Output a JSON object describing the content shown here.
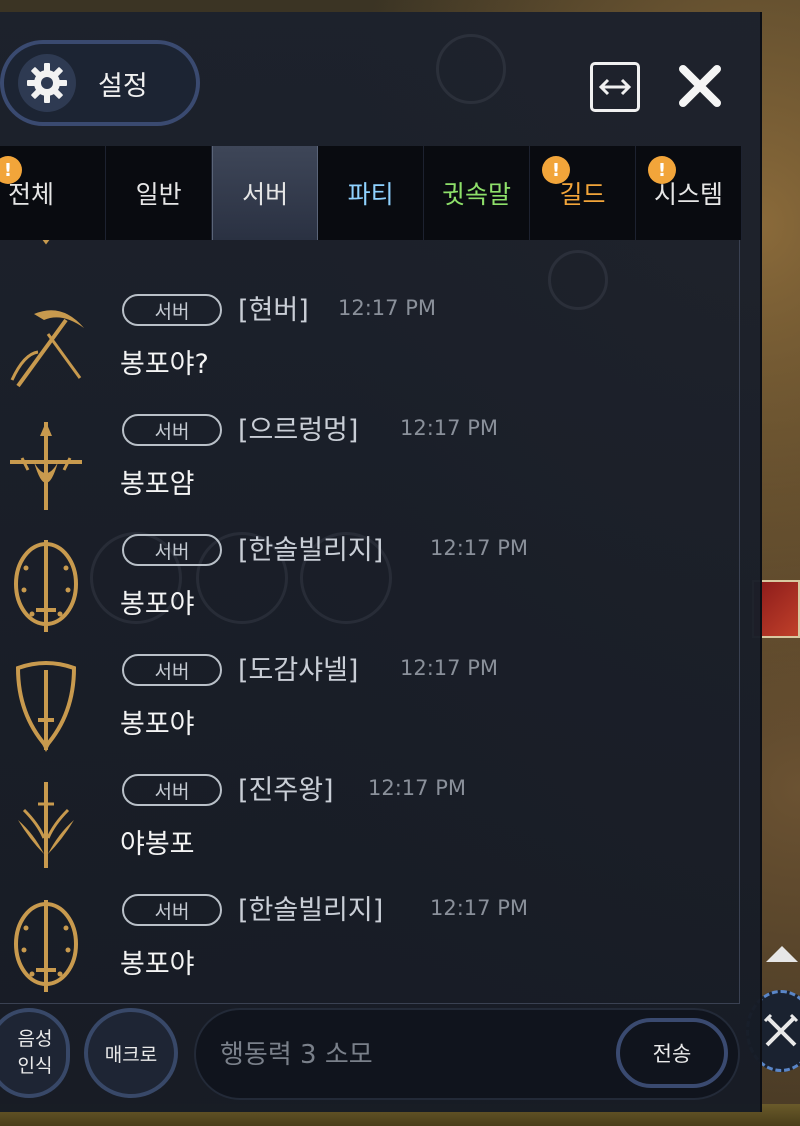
{
  "header": {
    "settings_label": "설정"
  },
  "tabs": [
    {
      "label": "전체",
      "alert": true,
      "color": "#e6e6e6"
    },
    {
      "label": "일반",
      "alert": false,
      "color": "#e6e6e6"
    },
    {
      "label": "서버",
      "alert": false,
      "color": "#e6e6e6",
      "active": true
    },
    {
      "label": "파티",
      "alert": false,
      "color": "#8fd2ff"
    },
    {
      "label": "귓속말",
      "alert": false,
      "color": "#8ee06a"
    },
    {
      "label": "길드",
      "alert": true,
      "color": "#f2a53a"
    },
    {
      "label": "시스템",
      "alert": true,
      "color": "#e6e6e6"
    }
  ],
  "alert_glyph": "!",
  "messages": [
    {
      "channel": "서버",
      "name": "[현버]",
      "time": "12:17 PM",
      "text": "봉포야?",
      "icon": "pickaxe-icon"
    },
    {
      "channel": "서버",
      "name": "[으르렁멍]",
      "time": "12:17 PM",
      "text": "봉포얌",
      "icon": "cross-sword-icon"
    },
    {
      "channel": "서버",
      "name": "[한솔빌리지]",
      "time": "12:17 PM",
      "text": "봉포야",
      "icon": "round-shield-icon"
    },
    {
      "channel": "서버",
      "name": "[도감샤넬]",
      "time": "12:17 PM",
      "text": "봉포야",
      "icon": "kite-shield-icon"
    },
    {
      "channel": "서버",
      "name": "[진주왕]",
      "time": "12:17 PM",
      "text": "야봉포",
      "icon": "winged-sword-icon"
    },
    {
      "channel": "서버",
      "name": "[한솔빌리지]",
      "time": "12:17 PM",
      "text": "봉포야",
      "icon": "round-shield-icon"
    }
  ],
  "bottom": {
    "voice_line1": "음성",
    "voice_line2": "인식",
    "macro_label": "매크로",
    "input_placeholder": "행동력 3 소모",
    "send_label": "전송"
  },
  "colors": {
    "accent_border": "#3a4a70",
    "gold_icon": "#c89a4e",
    "panel_bg": "#1c212c"
  }
}
